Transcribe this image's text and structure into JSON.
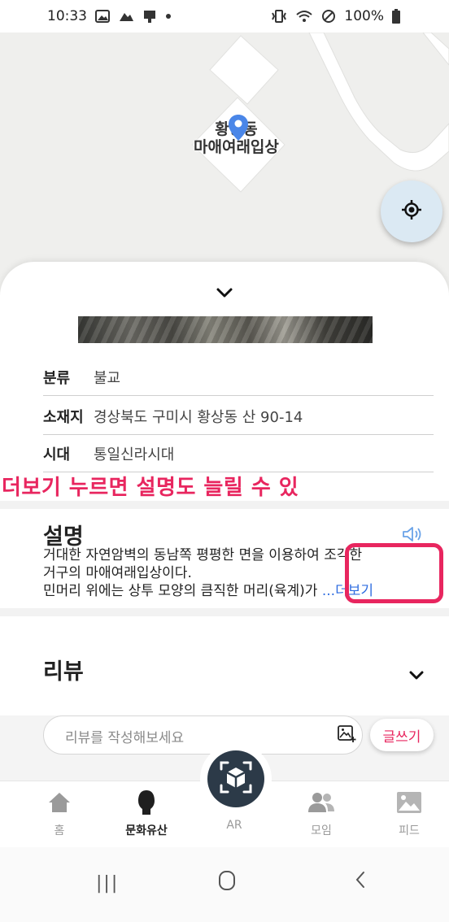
{
  "status_bar": {
    "time": "10:33",
    "battery": "100%",
    "left_icons": [
      "gallery-icon",
      "cloud-icon",
      "notification-icon",
      "dot-icon"
    ],
    "right_icons": [
      "vibrate-icon",
      "wifi-icon",
      "blocked-icon",
      "battery-icon"
    ]
  },
  "map": {
    "place_label_line1": "황상동",
    "place_label_line2": "마애여래입상",
    "pin_color": "#4a86e8"
  },
  "details": {
    "rows": [
      {
        "key": "분류",
        "value": "불교"
      },
      {
        "key": "소재지",
        "value": "경상북도 구미시 황상동 산 90-14"
      },
      {
        "key": "시대",
        "value": "통일신라시대"
      }
    ]
  },
  "overlay_banner": "더보기 누르면 설명도 늘릴 수 있",
  "description": {
    "title": "설명",
    "line1": "거대한 자연암벽의 동남쪽 평평한 면을 이용하여 조각한",
    "line2": "거구의 마애여래입상이다.",
    "line3": " 민머리 위에는 상투 모양의 큼직한 머리(육계)가 ",
    "more": "...더보기"
  },
  "review": {
    "title": "리뷰",
    "placeholder": "리뷰를 작성해보세요",
    "write_label": "글쓰기"
  },
  "bottom_nav": {
    "tabs": [
      {
        "label": "홈",
        "icon": "home-icon",
        "active": false
      },
      {
        "label": "문화유산",
        "icon": "heritage-icon",
        "active": true
      },
      {
        "label": "AR",
        "icon": "ar-cube-icon",
        "active": false
      },
      {
        "label": "모임",
        "icon": "people-icon",
        "active": false
      },
      {
        "label": "피드",
        "icon": "image-icon",
        "active": false
      }
    ]
  },
  "system_nav": {
    "recent": "|||",
    "home": "○",
    "back": "<"
  },
  "colors": {
    "accent": "#e8265f",
    "link": "#2f6de0",
    "ar_button": "#2c3a48",
    "locate_button": "#dbe9f3"
  }
}
